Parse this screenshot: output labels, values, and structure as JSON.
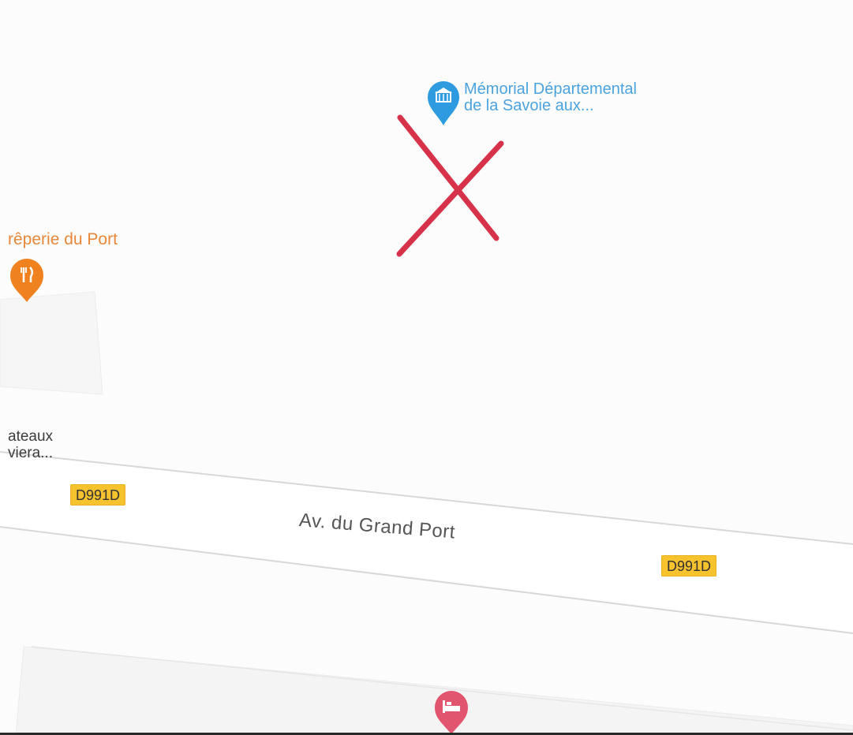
{
  "map": {
    "pois": {
      "museum": {
        "name_line1": "Mémorial Départemental",
        "name_line2": "de la Savoie aux...",
        "icon": "museum-icon",
        "color": "#2e9be0"
      },
      "restaurant": {
        "name": "rêperie du Port",
        "icon": "restaurant-icon",
        "color": "#f0811f"
      },
      "partial_place": {
        "name_line1": "ateaux",
        "name_line2": "viera..."
      },
      "hotel": {
        "icon": "hotel-icon",
        "color": "#e2556e"
      }
    },
    "road": {
      "name": "Av. du Grand Port",
      "shield_1": "D991D",
      "shield_2": "D991D",
      "shield_color": "#f6c22e"
    },
    "annotation": {
      "mark": "cross-mark",
      "color": "#d6324a"
    }
  }
}
